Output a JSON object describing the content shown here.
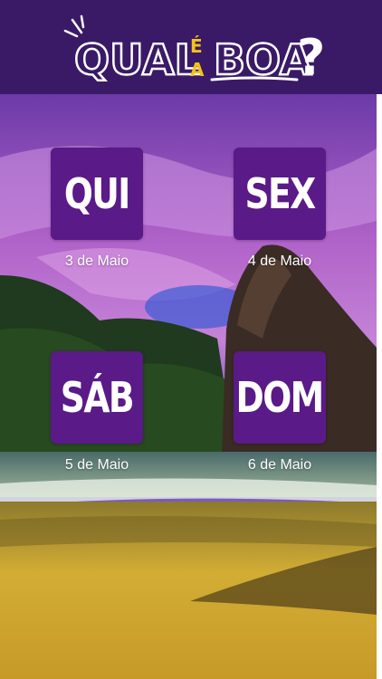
{
  "header": {
    "logo": {
      "word1": "QUAL",
      "word2": "É",
      "word3": "A",
      "word4": "BOA",
      "punct": "?"
    }
  },
  "days": [
    {
      "abbr": "QUI",
      "date": "3 de Maio"
    },
    {
      "abbr": "SEX",
      "date": "4 de Maio"
    },
    {
      "abbr": "SÁB",
      "date": "5 de Maio"
    },
    {
      "abbr": "DOM",
      "date": "6 de Maio"
    }
  ],
  "colors": {
    "header_bg": "#3a1a66",
    "tile_bg": "#5a1a87",
    "accent_yellow": "#f2c21a"
  }
}
